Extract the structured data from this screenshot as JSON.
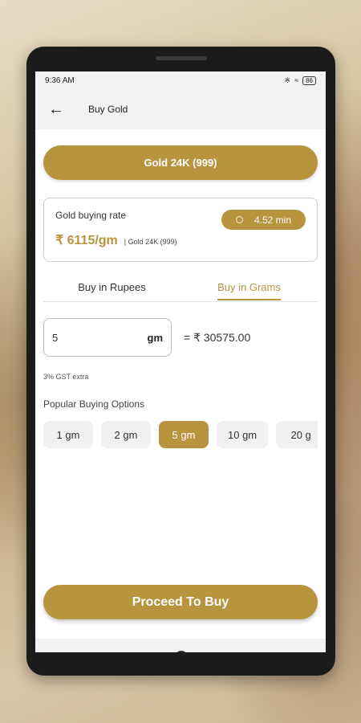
{
  "status": {
    "time": "9:36 AM",
    "signal": "♫ ▧ .❙",
    "battery": "86"
  },
  "header": {
    "title": "Buy Gold"
  },
  "product": {
    "label": "Gold 24K (999)"
  },
  "rate_card": {
    "label": "Gold buying rate",
    "timer": "4.52 min",
    "value": "₹ 6115/gm",
    "sub": "| Gold 24K (999)"
  },
  "tabs": [
    {
      "label": "Buy in Rupees",
      "active": false
    },
    {
      "label": "Buy in Grams",
      "active": true
    }
  ],
  "amount": {
    "value": "5",
    "unit": "gm",
    "total": "= ₹ 30575.00"
  },
  "gst_note": "3% GST extra",
  "popular": {
    "title": "Popular Buying Options",
    "options": [
      "1 gm",
      "2 gm",
      "5 gm",
      "10 gm",
      "20 g"
    ],
    "selected": "5 gm"
  },
  "cta": {
    "label": "Proceed To Buy"
  },
  "colors": {
    "accent": "#b8943e"
  }
}
